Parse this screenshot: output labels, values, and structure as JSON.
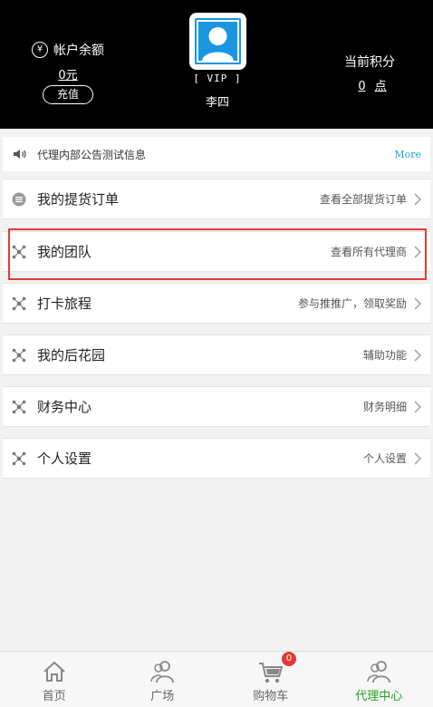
{
  "header": {
    "balance_title": "帐户余额",
    "balance_value": "0元",
    "recharge_label": "充值",
    "vip_label": "[ VIP ]",
    "username": "李四",
    "points_title": "当前积分",
    "points_value": "0",
    "points_unit": "点"
  },
  "notice": {
    "text": "代理内部公告测试信息",
    "more_label": "More"
  },
  "menu": [
    {
      "label": "我的提货订单",
      "right": "查看全部提货订单",
      "icon": "list-icon"
    },
    {
      "label": "我的团队",
      "right": "查看所有代理商",
      "icon": "share-nodes-icon"
    },
    {
      "label": "打卡旅程",
      "right": "参与推推广，领取奖励",
      "icon": "share-nodes-icon"
    },
    {
      "label": "我的后花园",
      "right": "辅助功能",
      "icon": "share-nodes-icon"
    },
    {
      "label": "财务中心",
      "right": "财务明细",
      "icon": "share-nodes-icon"
    },
    {
      "label": "个人设置",
      "right": "个人设置",
      "icon": "share-nodes-icon"
    }
  ],
  "nav": {
    "home": "首页",
    "plaza": "广场",
    "cart": "购物车",
    "cart_badge": "0",
    "agent": "代理中心"
  },
  "colors": {
    "header_bg": "#000000",
    "accent_green": "#1fa51f",
    "highlight_red": "#e53935",
    "more_link": "#1aa6c8",
    "avatar_blue": "#1a96e0"
  }
}
